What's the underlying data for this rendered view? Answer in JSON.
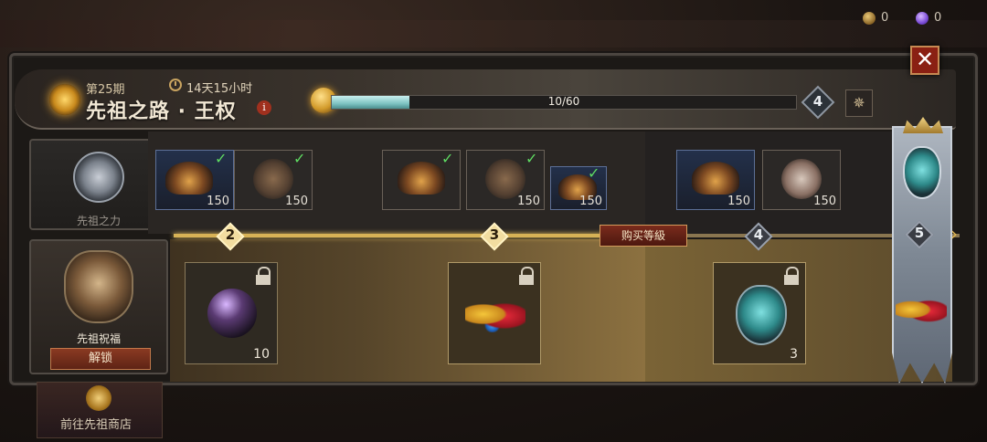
{
  "currency": [
    {
      "icon": "gold-coin-icon",
      "amount": "0"
    },
    {
      "icon": "purple-orb-icon",
      "amount": "0"
    }
  ],
  "header": {
    "season_label": "第25期",
    "title": "先祖之路 · 王权",
    "info_icon": "i",
    "time_remaining": "14天15小时",
    "progress": {
      "current": 10,
      "max": 60,
      "fraction": 0.1667,
      "text": "10/60"
    },
    "current_level": "4",
    "compass_icon": "✵"
  },
  "close_icon": "✕",
  "sidebar": {
    "power_label": "先祖之力",
    "blessing_label": "先祖祝福",
    "unlock_label": "解锁",
    "shop_label": "前往先祖商店"
  },
  "track": {
    "buy_level_label": "购买等級",
    "tiers": [
      "2",
      "3",
      "4",
      "5"
    ],
    "top_rewards": [
      {
        "count": "150",
        "claimed": true
      },
      {
        "count": "150",
        "claimed": true
      },
      {
        "count": "",
        "claimed": true
      },
      {
        "count": "150",
        "claimed": true
      },
      {
        "count": "150",
        "claimed": true
      },
      {
        "count": "150",
        "claimed": false
      },
      {
        "count": "150",
        "claimed": false
      }
    ],
    "bottom_rewards": [
      {
        "icon": "dark-orb-icon",
        "count": "10",
        "locked": true
      },
      {
        "icon": "gem-bundle-icon",
        "count": "",
        "locked": true
      },
      {
        "icon": "ancestor-mask-icon",
        "count": "3",
        "locked": true
      }
    ],
    "next_arrow": "›"
  },
  "colors": {
    "accent_gold": "#d7b256",
    "close_red": "#8a2013",
    "progress_teal": "#7ec3c2"
  }
}
